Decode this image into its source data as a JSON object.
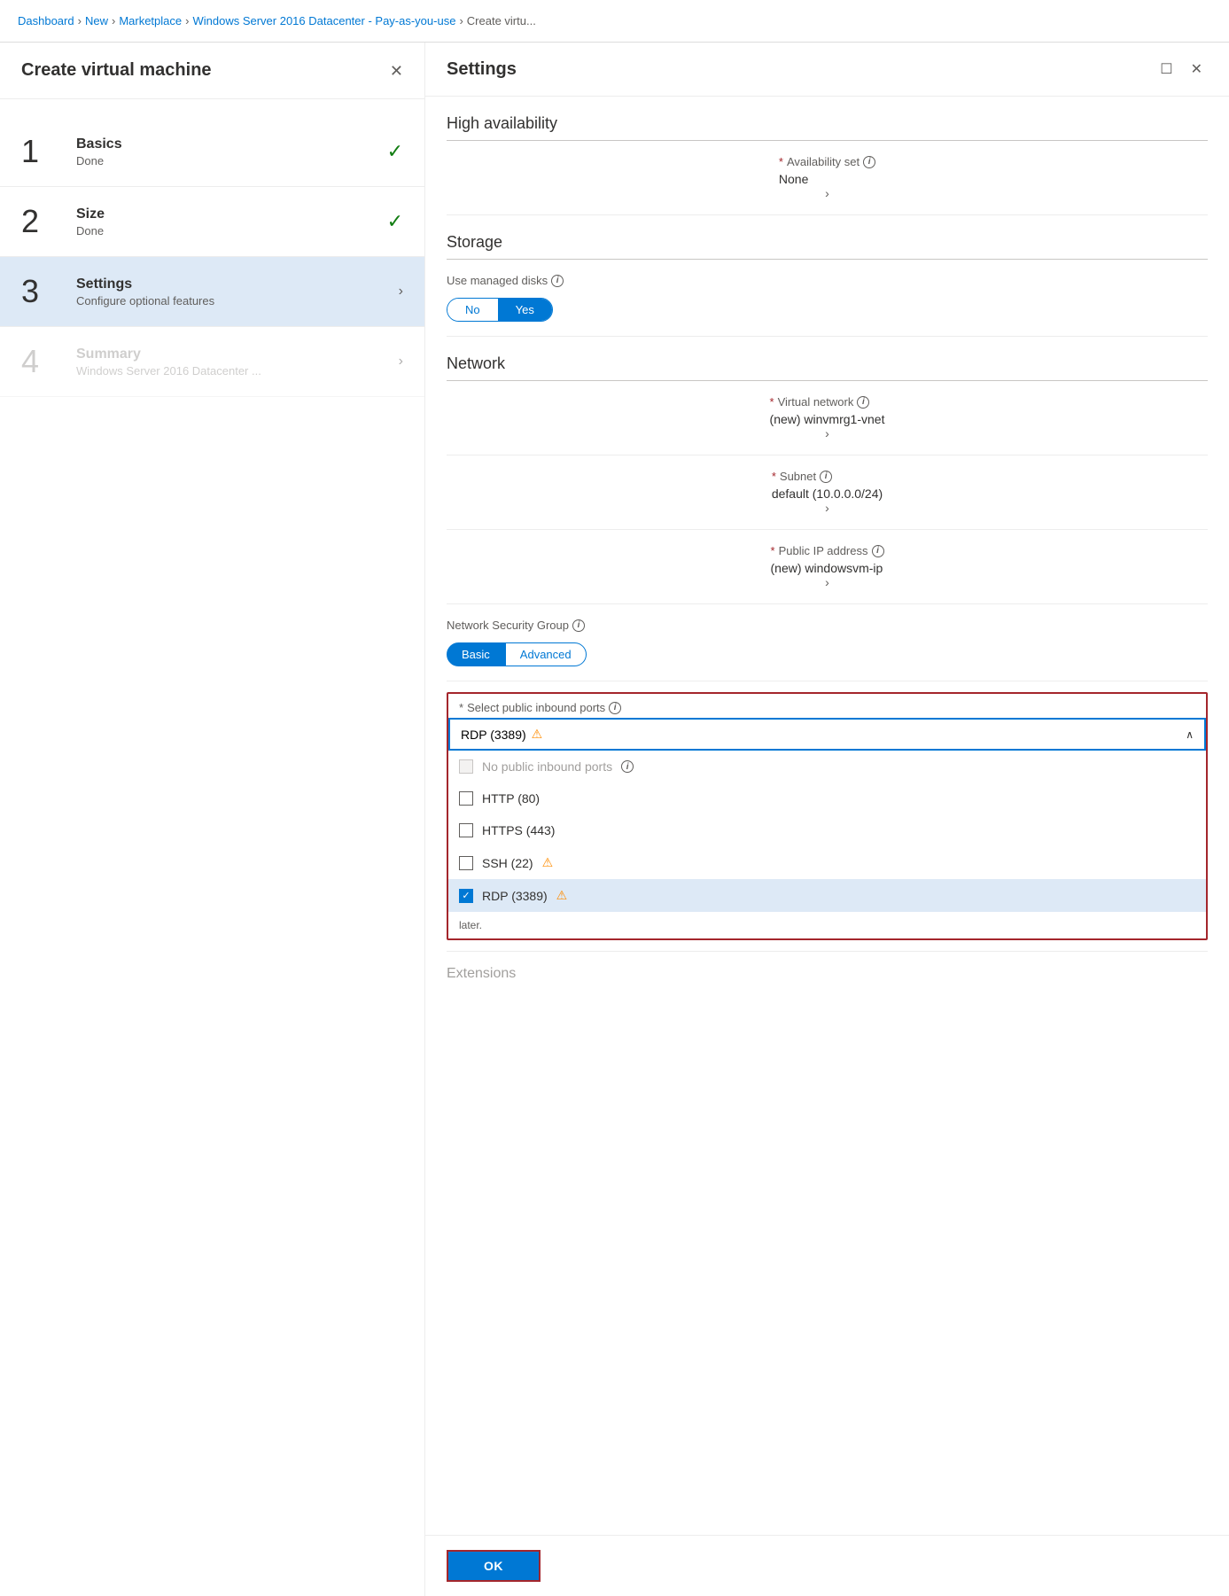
{
  "breadcrumb": {
    "items": [
      "Dashboard",
      "New",
      "Marketplace",
      "Windows Server 2016 Datacenter - Pay-as-you-use",
      "Create virtu..."
    ]
  },
  "left_panel": {
    "title": "Create virtual machine",
    "steps": [
      {
        "number": "1",
        "name": "Basics",
        "desc": "Done",
        "state": "done"
      },
      {
        "number": "2",
        "name": "Size",
        "desc": "Done",
        "state": "done"
      },
      {
        "number": "3",
        "name": "Settings",
        "desc": "Configure optional features",
        "state": "active"
      },
      {
        "number": "4",
        "name": "Summary",
        "desc": "Windows Server 2016 Datacenter ...",
        "state": "disabled"
      }
    ]
  },
  "right_panel": {
    "title": "Settings",
    "sections": {
      "high_availability": {
        "title": "High availability",
        "availability_set": {
          "label": "Availability set",
          "value": "None",
          "required": true
        }
      },
      "storage": {
        "title": "Storage",
        "managed_disks": {
          "label": "Use managed disks",
          "no_label": "No",
          "yes_label": "Yes",
          "selected": "Yes"
        }
      },
      "network": {
        "title": "Network",
        "virtual_network": {
          "label": "Virtual network",
          "value": "(new) winvmrg1-vnet",
          "required": true
        },
        "subnet": {
          "label": "Subnet",
          "value": "default (10.0.0.0/24)",
          "required": true
        },
        "public_ip": {
          "label": "Public IP address",
          "value": "(new) windowsvm-ip",
          "required": true
        },
        "nsg": {
          "label": "Network Security Group",
          "basic_label": "Basic",
          "advanced_label": "Advanced",
          "selected": "Basic"
        }
      },
      "inbound_ports": {
        "label": "Select public inbound ports",
        "selected_value": "RDP (3389)",
        "options": [
          {
            "label": "No public inbound ports",
            "checked": false,
            "disabled": true,
            "warning": false
          },
          {
            "label": "HTTP (80)",
            "checked": false,
            "disabled": false,
            "warning": false
          },
          {
            "label": "HTTPS (443)",
            "checked": false,
            "disabled": false,
            "warning": false
          },
          {
            "label": "SSH (22)",
            "checked": false,
            "disabled": false,
            "warning": true
          },
          {
            "label": "RDP (3389)",
            "checked": true,
            "disabled": false,
            "warning": true
          }
        ],
        "later_text": "later."
      }
    },
    "extension_label": "Extensions",
    "ok_label": "OK"
  }
}
